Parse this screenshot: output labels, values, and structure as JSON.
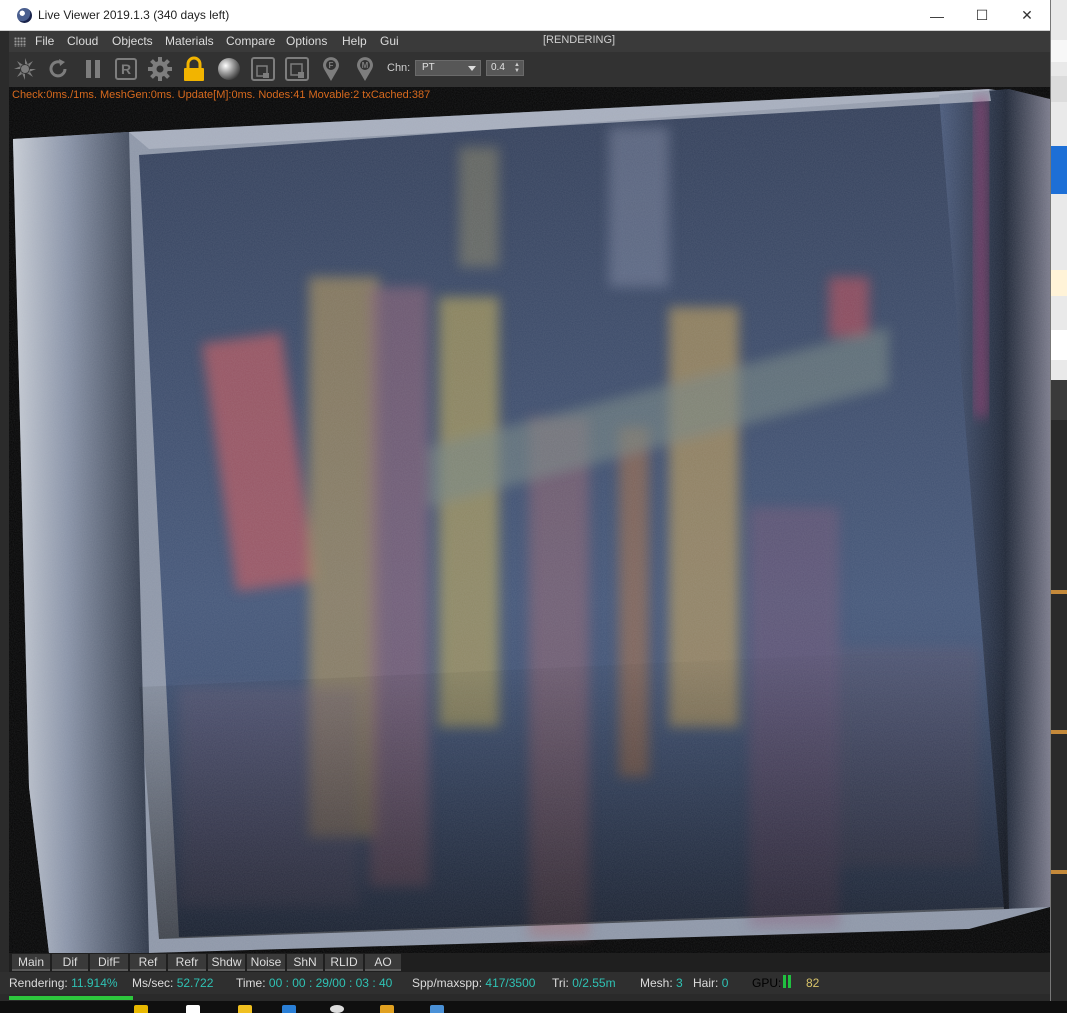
{
  "window": {
    "title": "Live Viewer 2019.1.3 (340 days left)",
    "controls": {
      "minimize": "—",
      "maximize": "☐",
      "close": "✕"
    }
  },
  "menu": {
    "items": [
      "File",
      "Cloud",
      "Objects",
      "Materials",
      "Compare",
      "Options",
      "Help",
      "Gui"
    ],
    "state": "[RENDERING]"
  },
  "toolbar": {
    "icons": [
      "octane-logo-icon",
      "restart-icon",
      "pause-icon",
      "reset-r-icon",
      "settings-gear-icon",
      "lock-icon",
      "material-sphere-icon",
      "region-render-icon",
      "film-region-icon",
      "focus-pick-icon",
      "material-pick-icon"
    ],
    "lock_color": "#f2b400",
    "channel_label": "Chn:",
    "channel_value": "PT",
    "spinner_value": "0.4"
  },
  "viewport": {
    "stats": "Check:0ms./1ms. MeshGen:0ms. Update[M]:0ms. Nodes:41 Movable:2 txCached:387",
    "stats_color": "#d86a1e"
  },
  "passes": [
    "Main",
    "Dif",
    "DifF",
    "Ref",
    "Refr",
    "Shdw",
    "Noise",
    "ShN",
    "RLID",
    "AO"
  ],
  "status": {
    "rendering_label": "Rendering:",
    "rendering_value": "11.914%",
    "mssec_label": "Ms/sec:",
    "mssec_value": "52.722",
    "time_label": "Time:",
    "time_value": "00 : 00 : 29/00 : 03 : 40",
    "spp_label": "Spp/maxspp:",
    "spp_value": "417/3500",
    "tri_label": "Tri:",
    "tri_value": "0/2.55m",
    "mesh_label": "Mesh:",
    "mesh_value": "3",
    "hair_label": "Hair:",
    "hair_value": "0",
    "gpu_label": "GPU:",
    "gpu_value": "82",
    "progress": 0.119,
    "value_color": "#2fc2b4",
    "progress_color": "#2dc73d"
  }
}
